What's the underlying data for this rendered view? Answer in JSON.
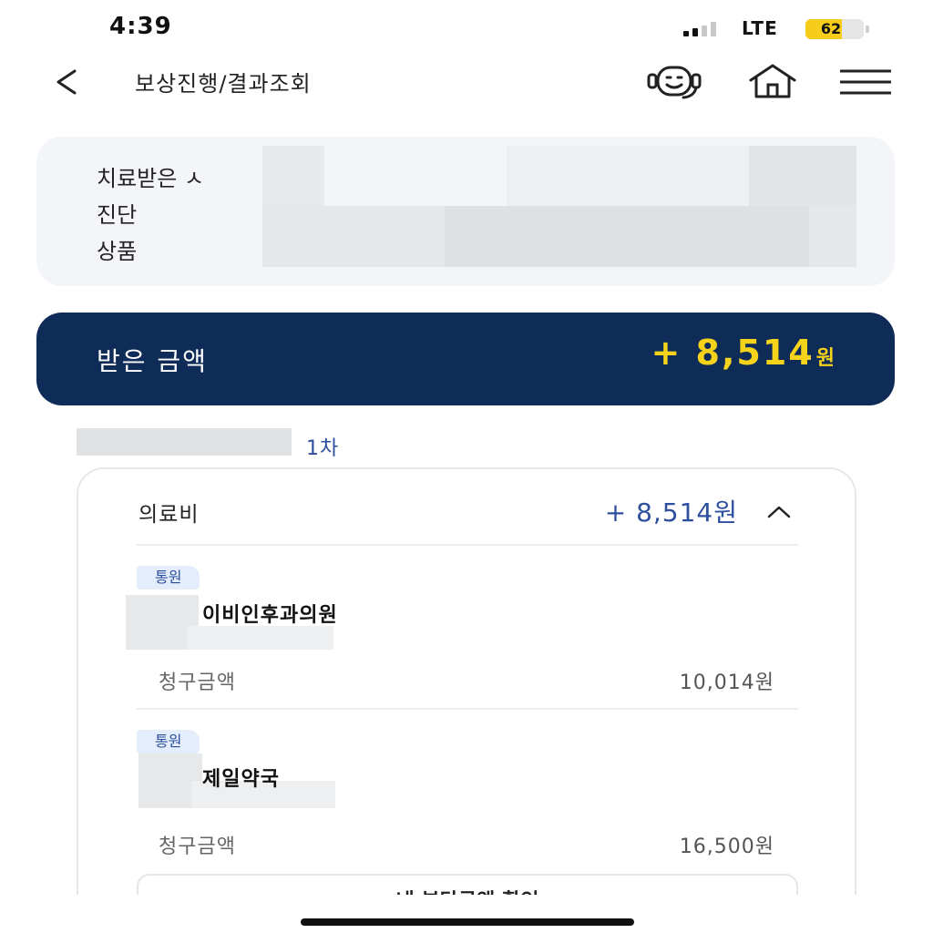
{
  "status_bar": {
    "time": "4:39",
    "network": "LTE",
    "battery": "62",
    "battery_level": 0.62,
    "battery_color": "#f7cd1c"
  },
  "header": {
    "title": "보상진행/결과조회",
    "icons": [
      "back-icon",
      "chatbot-icon",
      "home-icon",
      "menu-icon"
    ]
  },
  "info": {
    "rows": [
      {
        "label": "치료받은 ㅅ"
      },
      {
        "label": "진단"
      },
      {
        "label": "상품"
      }
    ]
  },
  "banner": {
    "label": "받은 금액",
    "amount": "+ 8,514",
    "unit": "원",
    "bg_color": "#0f2b57",
    "amount_color": "#f6d31b"
  },
  "round": {
    "label": "1차"
  },
  "card": {
    "title": "의료비",
    "total": "+ 8,514원",
    "items": [
      {
        "badge": "통원",
        "name": "이비인후과의원",
        "amount_label": "청구금액",
        "amount": "10,014원"
      },
      {
        "badge": "통원",
        "name": "제일약국",
        "amount_label": "청구금액",
        "amount": "16,500원"
      }
    ],
    "bottom_button": "내 부담금액 확인"
  },
  "colors": {
    "accent_blue": "#2d4f9e",
    "badge_bg": "#e4edfb",
    "info_bg": "#f3f5f9"
  }
}
